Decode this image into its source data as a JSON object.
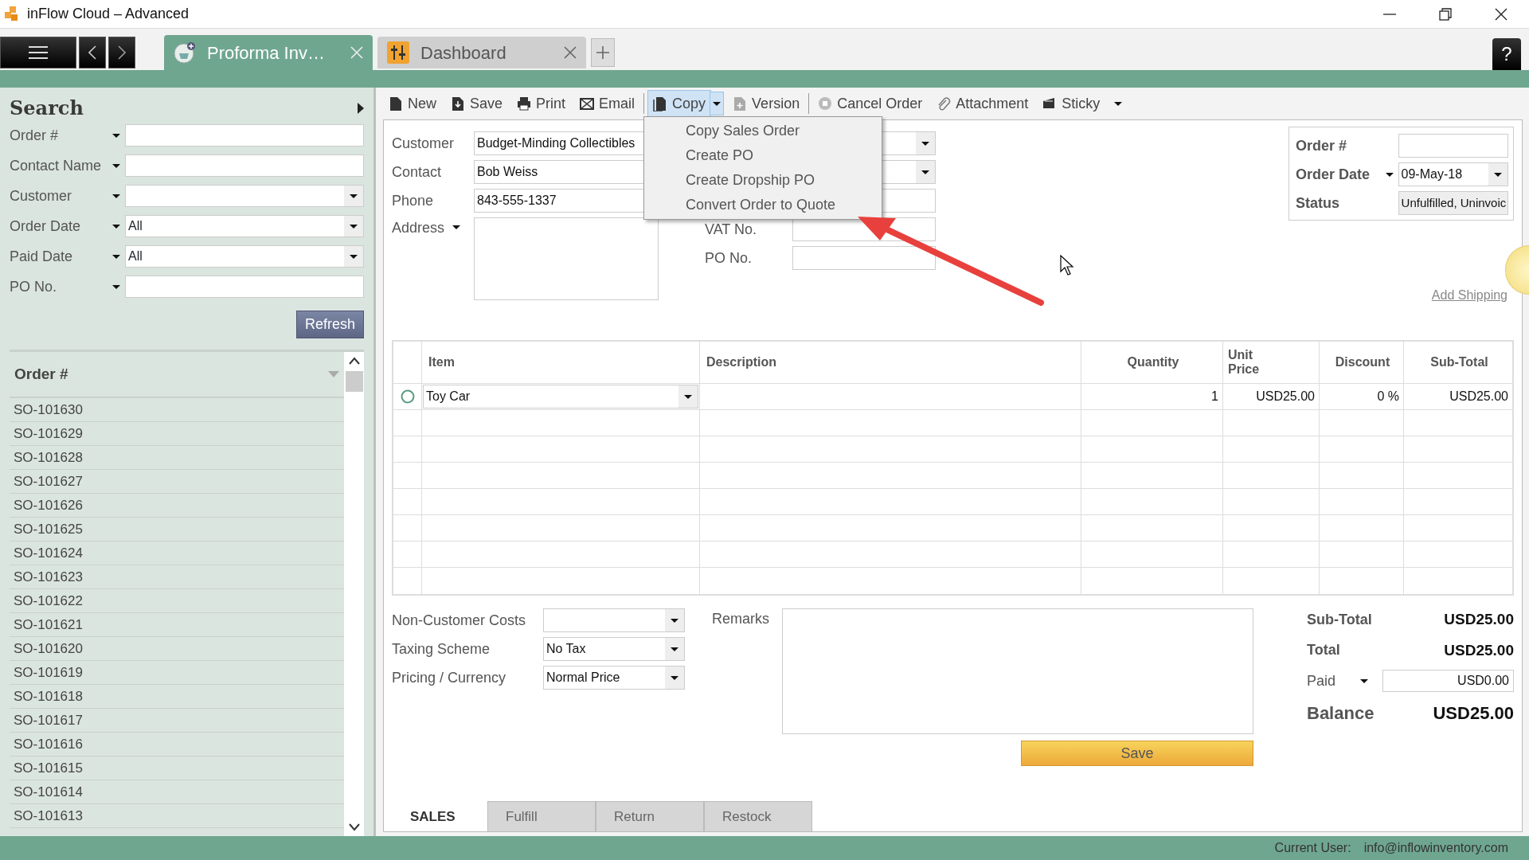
{
  "window": {
    "title": "inFlow Cloud – Advanced",
    "help": "?"
  },
  "tabs": [
    {
      "label": "Proforma Inv…",
      "selected": true,
      "kind": "sales"
    },
    {
      "label": "Dashboard",
      "selected": false,
      "kind": "dashboard"
    }
  ],
  "toolbar": [
    {
      "label": "New",
      "kind": "new",
      "pressed": false
    },
    {
      "label": "Save",
      "kind": "save",
      "pressed": false
    },
    {
      "label": "Print",
      "kind": "print",
      "pressed": false
    },
    {
      "label": "Email",
      "kind": "email",
      "pressed": false
    },
    {
      "label": "Copy",
      "kind": "copy",
      "pressed": true
    },
    {
      "label": "Version",
      "kind": "version",
      "pressed": false
    },
    {
      "label": "Cancel Order",
      "kind": "cancel",
      "pressed": false
    },
    {
      "label": "Attachment",
      "kind": "attachment",
      "pressed": false
    },
    {
      "label": "Sticky",
      "kind": "sticky",
      "pressed": false
    }
  ],
  "copy_menu": [
    "Copy Sales Order",
    "Create PO",
    "Create Dropship PO",
    "Convert Order to Quote"
  ],
  "search": {
    "title": "Search",
    "filters": [
      {
        "label": "Order #",
        "kind": "text"
      },
      {
        "label": "Contact Name",
        "kind": "text"
      },
      {
        "label": "Customer",
        "kind": "select"
      },
      {
        "label": "Order Date",
        "kind": "select",
        "value": "All"
      },
      {
        "label": "Paid Date",
        "kind": "select",
        "value": "All"
      },
      {
        "label": "PO No.",
        "kind": "text"
      }
    ],
    "refresh": "Refresh"
  },
  "order_list": {
    "header": "Order #",
    "rows": [
      "SO-101630",
      "SO-101629",
      "SO-101628",
      "SO-101627",
      "SO-101626",
      "SO-101625",
      "SO-101624",
      "SO-101623",
      "SO-101622",
      "SO-101621",
      "SO-101620",
      "SO-101619",
      "SO-101618",
      "SO-101617",
      "SO-101616",
      "SO-101615",
      "SO-101614",
      "SO-101613"
    ]
  },
  "customer": [
    {
      "label": "Customer",
      "value": "Budget-Minding Collectibles"
    },
    {
      "label": "Contact",
      "value": "Bob Weiss"
    },
    {
      "label": "Phone",
      "value": "843-555-1337"
    }
  ],
  "address": {
    "label": "Address"
  },
  "right_fields": [
    {
      "kind": "select"
    },
    {
      "kind": "select"
    },
    {
      "kind": "text"
    },
    {
      "kind": "text",
      "label": "VAT No."
    },
    {
      "kind": "text",
      "label": "PO No."
    }
  ],
  "order_info": {
    "order_no": {
      "label": "Order #"
    },
    "order_date": {
      "label": "Order Date",
      "value": "09-May-18"
    },
    "status": {
      "label": "Status",
      "value": "Unfulfilled, Uninvoic"
    }
  },
  "add_shipping": "Add Shipping",
  "table": {
    "columns": [
      "Item",
      "Description",
      "Quantity",
      "Unit Price",
      "Discount",
      "Sub-Total"
    ],
    "rows": [
      {
        "item": "Toy Car",
        "quantity": "1",
        "unit_price": "USD25.00",
        "discount": "0 %",
        "subtotal": "USD25.00"
      }
    ]
  },
  "options": [
    {
      "label": "Non-Customer Costs"
    },
    {
      "label": "Taxing Scheme",
      "value": "No Tax"
    },
    {
      "label": "Pricing / Currency",
      "value": "Normal Price"
    }
  ],
  "remarks": {
    "label": "Remarks"
  },
  "totals": {
    "subtotal": {
      "label": "Sub-Total",
      "value": "USD25.00"
    },
    "total": {
      "label": "Total",
      "value": "USD25.00"
    },
    "paid": {
      "label": "Paid",
      "value": "USD0.00"
    },
    "balance": {
      "label": "Balance",
      "value": "USD25.00"
    }
  },
  "save_button": "Save",
  "bottom_tabs": [
    {
      "label": "SALES",
      "selected": true
    },
    {
      "label": "Fulfill",
      "selected": false
    },
    {
      "label": "Return",
      "selected": false
    },
    {
      "label": "Restock",
      "selected": false
    }
  ],
  "status_bar": {
    "label": "Current User:",
    "user": "info@inflowinventory.com"
  }
}
